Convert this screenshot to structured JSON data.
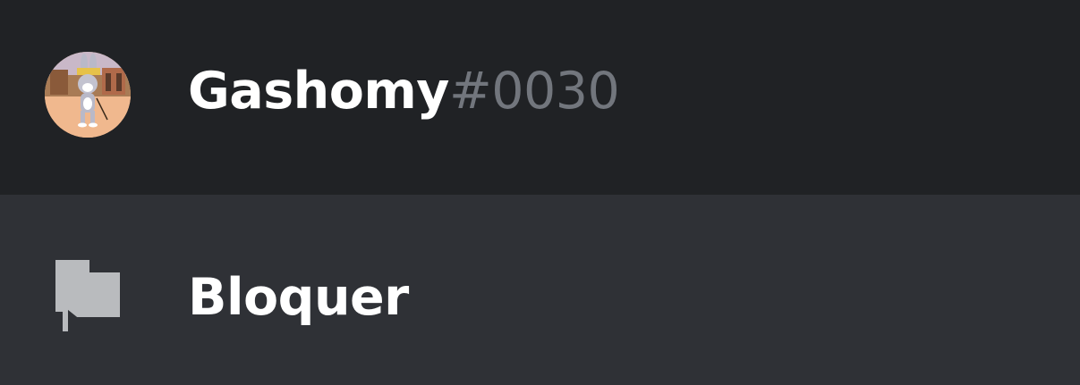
{
  "user": {
    "username": "Gashomy",
    "discriminator": "#0030",
    "avatar_icon": "avatar-bugs-bunny"
  },
  "menu": {
    "items": [
      {
        "label": "Bloquer",
        "icon": "flag-icon"
      }
    ]
  },
  "colors": {
    "header_bg": "#202225",
    "menu_bg": "#2f3136",
    "text_primary": "#ffffff",
    "text_muted": "#72767d",
    "icon_color": "#b9bbbe"
  }
}
